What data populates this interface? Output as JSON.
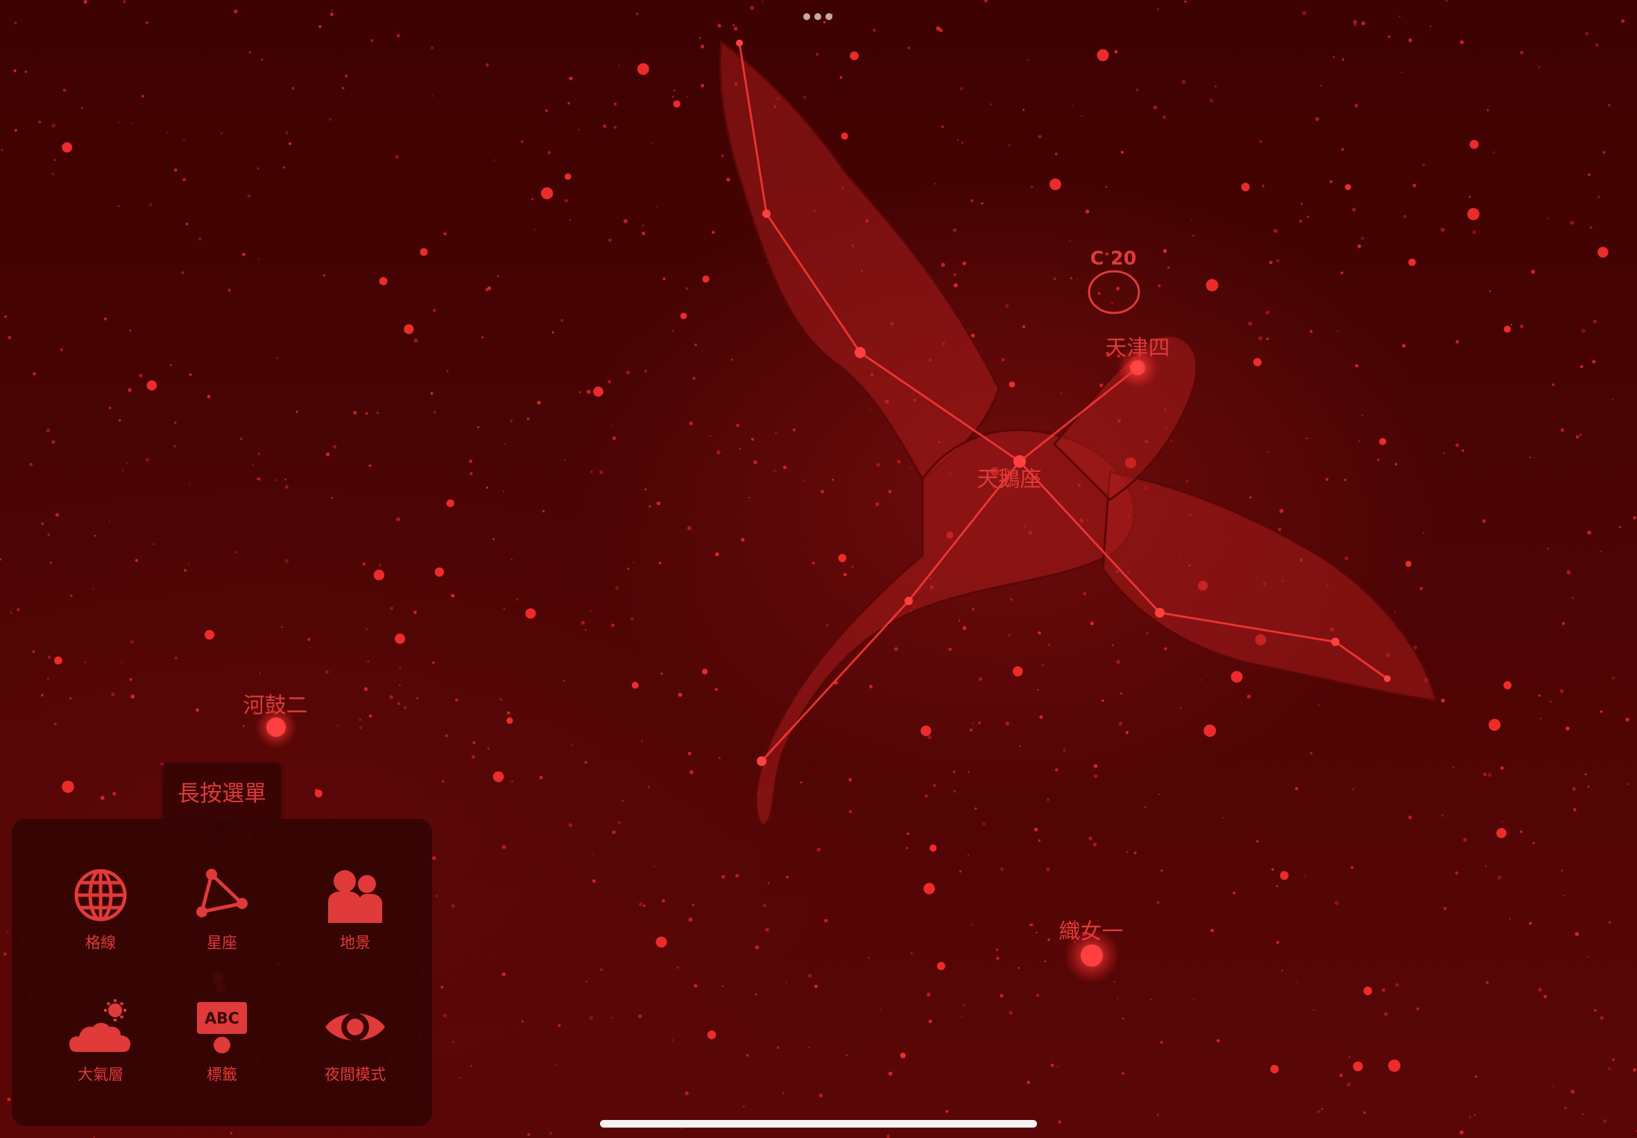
{
  "app": {
    "more_menu_icon": "ellipsis-icon",
    "home_indicator": "home-indicator"
  },
  "colors": {
    "night_red": "#e03a3a",
    "background": "#4a0303",
    "panel": "#340404"
  },
  "sky": {
    "labels": {
      "c20": "C 20",
      "deneb": "天津四",
      "cygnus": "天鵝座",
      "altair_region_star": "河鼓二",
      "vega": "織女一"
    }
  },
  "tooltip": {
    "text": "長按選單"
  },
  "menu": {
    "items": [
      {
        "label": "格線",
        "icon": "globe-grid-icon"
      },
      {
        "label": "星座",
        "icon": "constellation-icon"
      },
      {
        "label": "地景",
        "icon": "landscape-people-icon"
      },
      {
        "label": "大氣層",
        "icon": "cloud-sun-icon"
      },
      {
        "label": "標籤",
        "icon": "abc-label-icon",
        "badge": "ABC"
      },
      {
        "label": "夜間模式",
        "icon": "eye-icon"
      }
    ]
  }
}
